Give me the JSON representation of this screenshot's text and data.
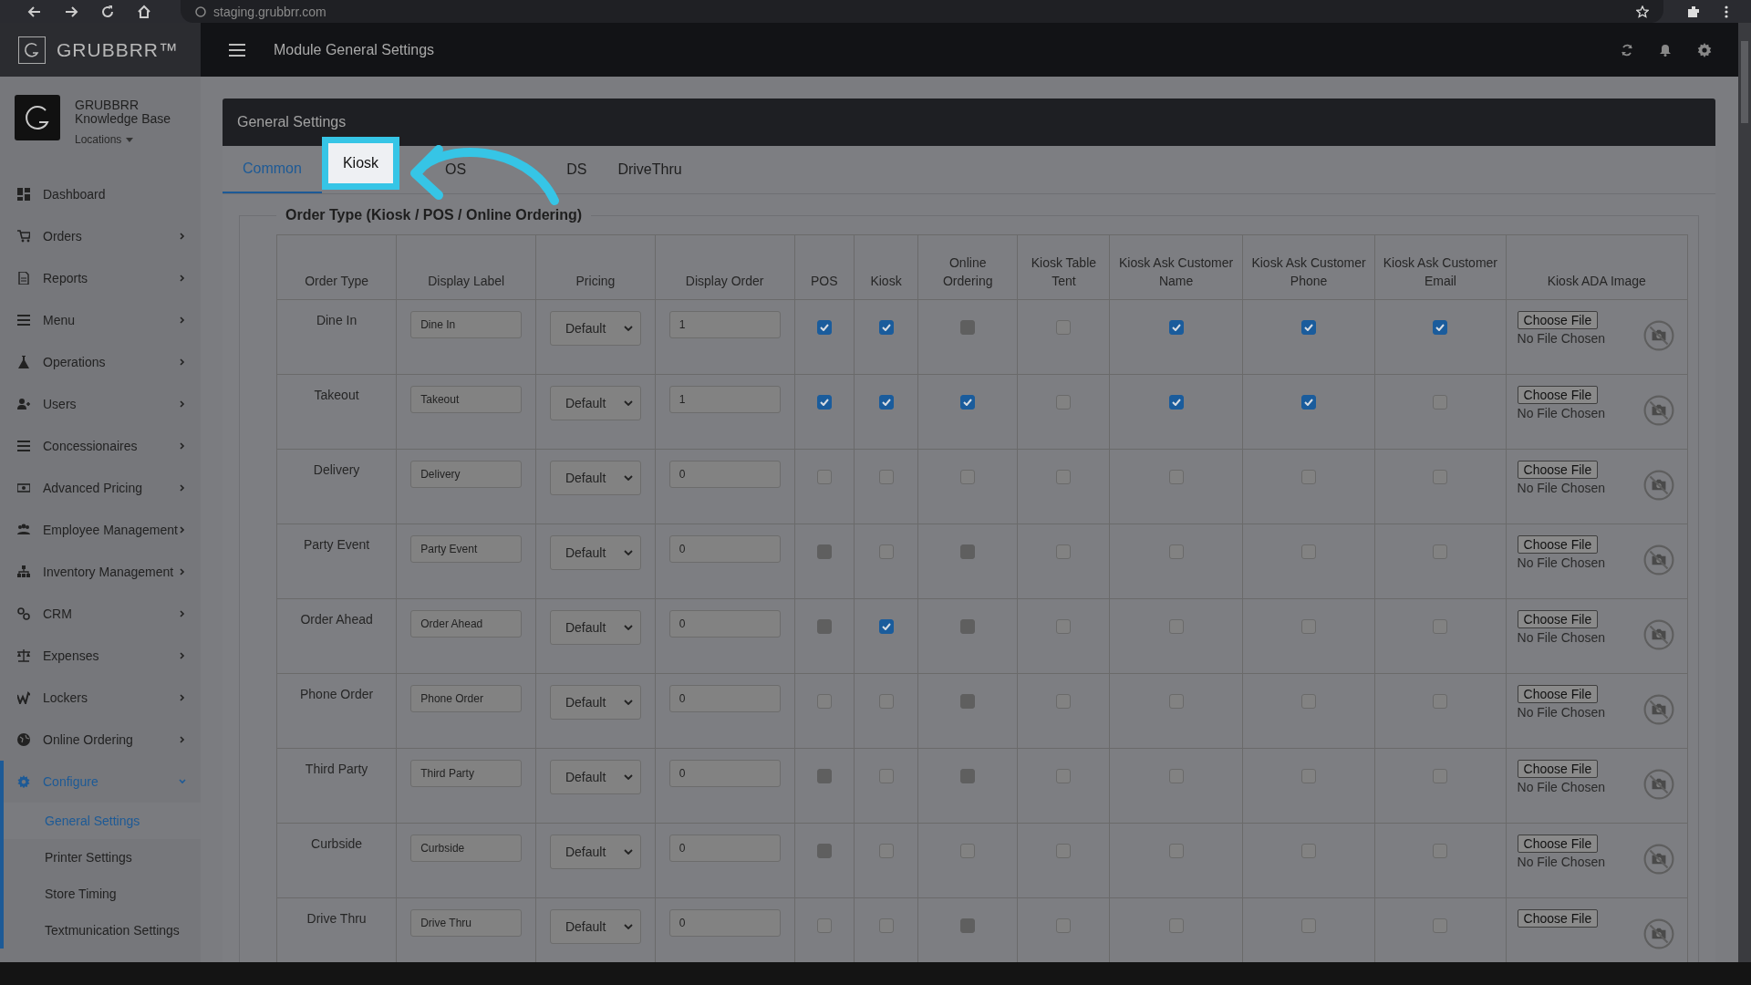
{
  "browser": {
    "url": "staging.grubbrr.com"
  },
  "app_header": {
    "logo_text": "GRUBBRR™",
    "title": "Module General Settings"
  },
  "sidebar": {
    "account": {
      "name": "GRUBBRR",
      "subtitle": "Knowledge Base",
      "locations": "Locations"
    },
    "items": [
      {
        "label": "Dashboard",
        "selected": false
      },
      {
        "label": "Orders",
        "selected": false,
        "expanded": false
      },
      {
        "label": "Reports",
        "selected": false,
        "expanded": false
      },
      {
        "label": "Menu",
        "selected": false,
        "expanded": false
      },
      {
        "label": "Operations",
        "selected": false,
        "expanded": false
      },
      {
        "label": "Users",
        "selected": false,
        "expanded": false
      },
      {
        "label": "Concessionaires",
        "selected": false,
        "expanded": false
      },
      {
        "label": "Advanced Pricing",
        "selected": false,
        "expanded": false
      },
      {
        "label": "Employee Management",
        "selected": false,
        "expanded": false
      },
      {
        "label": "Inventory Management",
        "selected": false,
        "expanded": false
      },
      {
        "label": "CRM",
        "selected": false,
        "expanded": false
      },
      {
        "label": "Expenses",
        "selected": false,
        "expanded": false
      },
      {
        "label": "Lockers",
        "selected": false,
        "expanded": false
      },
      {
        "label": "Online Ordering",
        "selected": false,
        "expanded": false
      },
      {
        "label": "Configure",
        "selected": true,
        "expanded": true,
        "children": [
          {
            "label": "General Settings",
            "selected": true
          },
          {
            "label": "Printer Settings",
            "selected": false
          },
          {
            "label": "Store Timing",
            "selected": false
          },
          {
            "label": "Textmunication Settings",
            "selected": false
          }
        ]
      }
    ]
  },
  "panel": {
    "title": "General Settings",
    "tabs": [
      {
        "label": "Common",
        "selected": true,
        "highlighted": false
      },
      {
        "label": "Kiosk",
        "selected": false,
        "highlighted": true
      },
      {
        "label": "OS",
        "selected": false,
        "highlighted": false
      },
      {
        "label": "DS",
        "selected": false,
        "highlighted": false
      },
      {
        "label": "DriveThru",
        "selected": false,
        "highlighted": false
      }
    ],
    "section": {
      "legend": "Order Type (Kiosk / POS / Online Ordering)",
      "table": {
        "columns": [
          "Order Type",
          "Display Label",
          "Pricing",
          "Display Order",
          "POS",
          "Kiosk",
          "Online Ordering",
          "Kiosk Table Tent",
          "Kiosk Ask Customer Name",
          "Kiosk Ask Customer Phone",
          "Kiosk Ask Customer Email",
          "Kiosk ADA Image"
        ],
        "rows": [
          {
            "order_type": "Dine In",
            "display_label": "Dine In",
            "pricing": "Default",
            "display_order": "1",
            "checks": [
              {
                "checked": true,
                "disabled": false
              },
              {
                "checked": true,
                "disabled": false
              },
              {
                "checked": false,
                "disabled": true
              },
              {
                "checked": false,
                "disabled": false
              },
              {
                "checked": true,
                "disabled": false
              },
              {
                "checked": true,
                "disabled": false
              },
              {
                "checked": true,
                "disabled": false
              }
            ],
            "file_button": "Choose File",
            "file_status": "No File Chosen"
          },
          {
            "order_type": "Takeout",
            "display_label": "Takeout",
            "pricing": "Default",
            "display_order": "1",
            "checks": [
              {
                "checked": true,
                "disabled": false
              },
              {
                "checked": true,
                "disabled": false
              },
              {
                "checked": true,
                "disabled": false
              },
              {
                "checked": false,
                "disabled": false
              },
              {
                "checked": true,
                "disabled": false
              },
              {
                "checked": true,
                "disabled": false
              },
              {
                "checked": false,
                "disabled": false
              }
            ],
            "file_button": "Choose File",
            "file_status": "No File Chosen"
          },
          {
            "order_type": "Delivery",
            "display_label": "Delivery",
            "pricing": "Default",
            "display_order": "0",
            "checks": [
              {
                "checked": false,
                "disabled": false
              },
              {
                "checked": false,
                "disabled": false
              },
              {
                "checked": false,
                "disabled": false
              },
              {
                "checked": false,
                "disabled": false
              },
              {
                "checked": false,
                "disabled": false
              },
              {
                "checked": false,
                "disabled": false
              },
              {
                "checked": false,
                "disabled": false
              }
            ],
            "file_button": "Choose File",
            "file_status": "No File Chosen"
          },
          {
            "order_type": "Party Event",
            "display_label": "Party Event",
            "pricing": "Default",
            "display_order": "0",
            "checks": [
              {
                "checked": false,
                "disabled": true
              },
              {
                "checked": false,
                "disabled": false
              },
              {
                "checked": false,
                "disabled": true
              },
              {
                "checked": false,
                "disabled": false
              },
              {
                "checked": false,
                "disabled": false
              },
              {
                "checked": false,
                "disabled": false
              },
              {
                "checked": false,
                "disabled": false
              }
            ],
            "file_button": "Choose File",
            "file_status": "No File Chosen"
          },
          {
            "order_type": "Order Ahead",
            "display_label": "Order Ahead",
            "pricing": "Default",
            "display_order": "0",
            "checks": [
              {
                "checked": false,
                "disabled": true
              },
              {
                "checked": true,
                "disabled": false
              },
              {
                "checked": false,
                "disabled": true
              },
              {
                "checked": false,
                "disabled": false
              },
              {
                "checked": false,
                "disabled": false
              },
              {
                "checked": false,
                "disabled": false
              },
              {
                "checked": false,
                "disabled": false
              }
            ],
            "file_button": "Choose File",
            "file_status": "No File Chosen"
          },
          {
            "order_type": "Phone Order",
            "display_label": "Phone Order",
            "pricing": "Default",
            "display_order": "0",
            "checks": [
              {
                "checked": false,
                "disabled": false
              },
              {
                "checked": false,
                "disabled": false
              },
              {
                "checked": false,
                "disabled": true
              },
              {
                "checked": false,
                "disabled": false
              },
              {
                "checked": false,
                "disabled": false
              },
              {
                "checked": false,
                "disabled": false
              },
              {
                "checked": false,
                "disabled": false
              }
            ],
            "file_button": "Choose File",
            "file_status": "No File Chosen"
          },
          {
            "order_type": "Third Party",
            "display_label": "Third Party",
            "pricing": "Default",
            "display_order": "0",
            "checks": [
              {
                "checked": false,
                "disabled": true
              },
              {
                "checked": false,
                "disabled": false
              },
              {
                "checked": false,
                "disabled": true
              },
              {
                "checked": false,
                "disabled": false
              },
              {
                "checked": false,
                "disabled": false
              },
              {
                "checked": false,
                "disabled": false
              },
              {
                "checked": false,
                "disabled": false
              }
            ],
            "file_button": "Choose File",
            "file_status": "No File Chosen"
          },
          {
            "order_type": "Curbside",
            "display_label": "Curbside",
            "pricing": "Default",
            "display_order": "0",
            "checks": [
              {
                "checked": false,
                "disabled": true
              },
              {
                "checked": false,
                "disabled": false
              },
              {
                "checked": false,
                "disabled": false
              },
              {
                "checked": false,
                "disabled": false
              },
              {
                "checked": false,
                "disabled": false
              },
              {
                "checked": false,
                "disabled": false
              },
              {
                "checked": false,
                "disabled": false
              }
            ],
            "file_button": "Choose File",
            "file_status": "No File Chosen"
          },
          {
            "order_type": "Drive Thru",
            "display_label": "Drive Thru",
            "pricing": "Default",
            "display_order": "0",
            "checks": [
              {
                "checked": false,
                "disabled": false
              },
              {
                "checked": false,
                "disabled": false
              },
              {
                "checked": false,
                "disabled": true
              },
              {
                "checked": false,
                "disabled": false
              },
              {
                "checked": false,
                "disabled": false
              },
              {
                "checked": false,
                "disabled": false
              },
              {
                "checked": false,
                "disabled": false
              }
            ],
            "file_button": "Choose File"
          }
        ]
      }
    }
  }
}
